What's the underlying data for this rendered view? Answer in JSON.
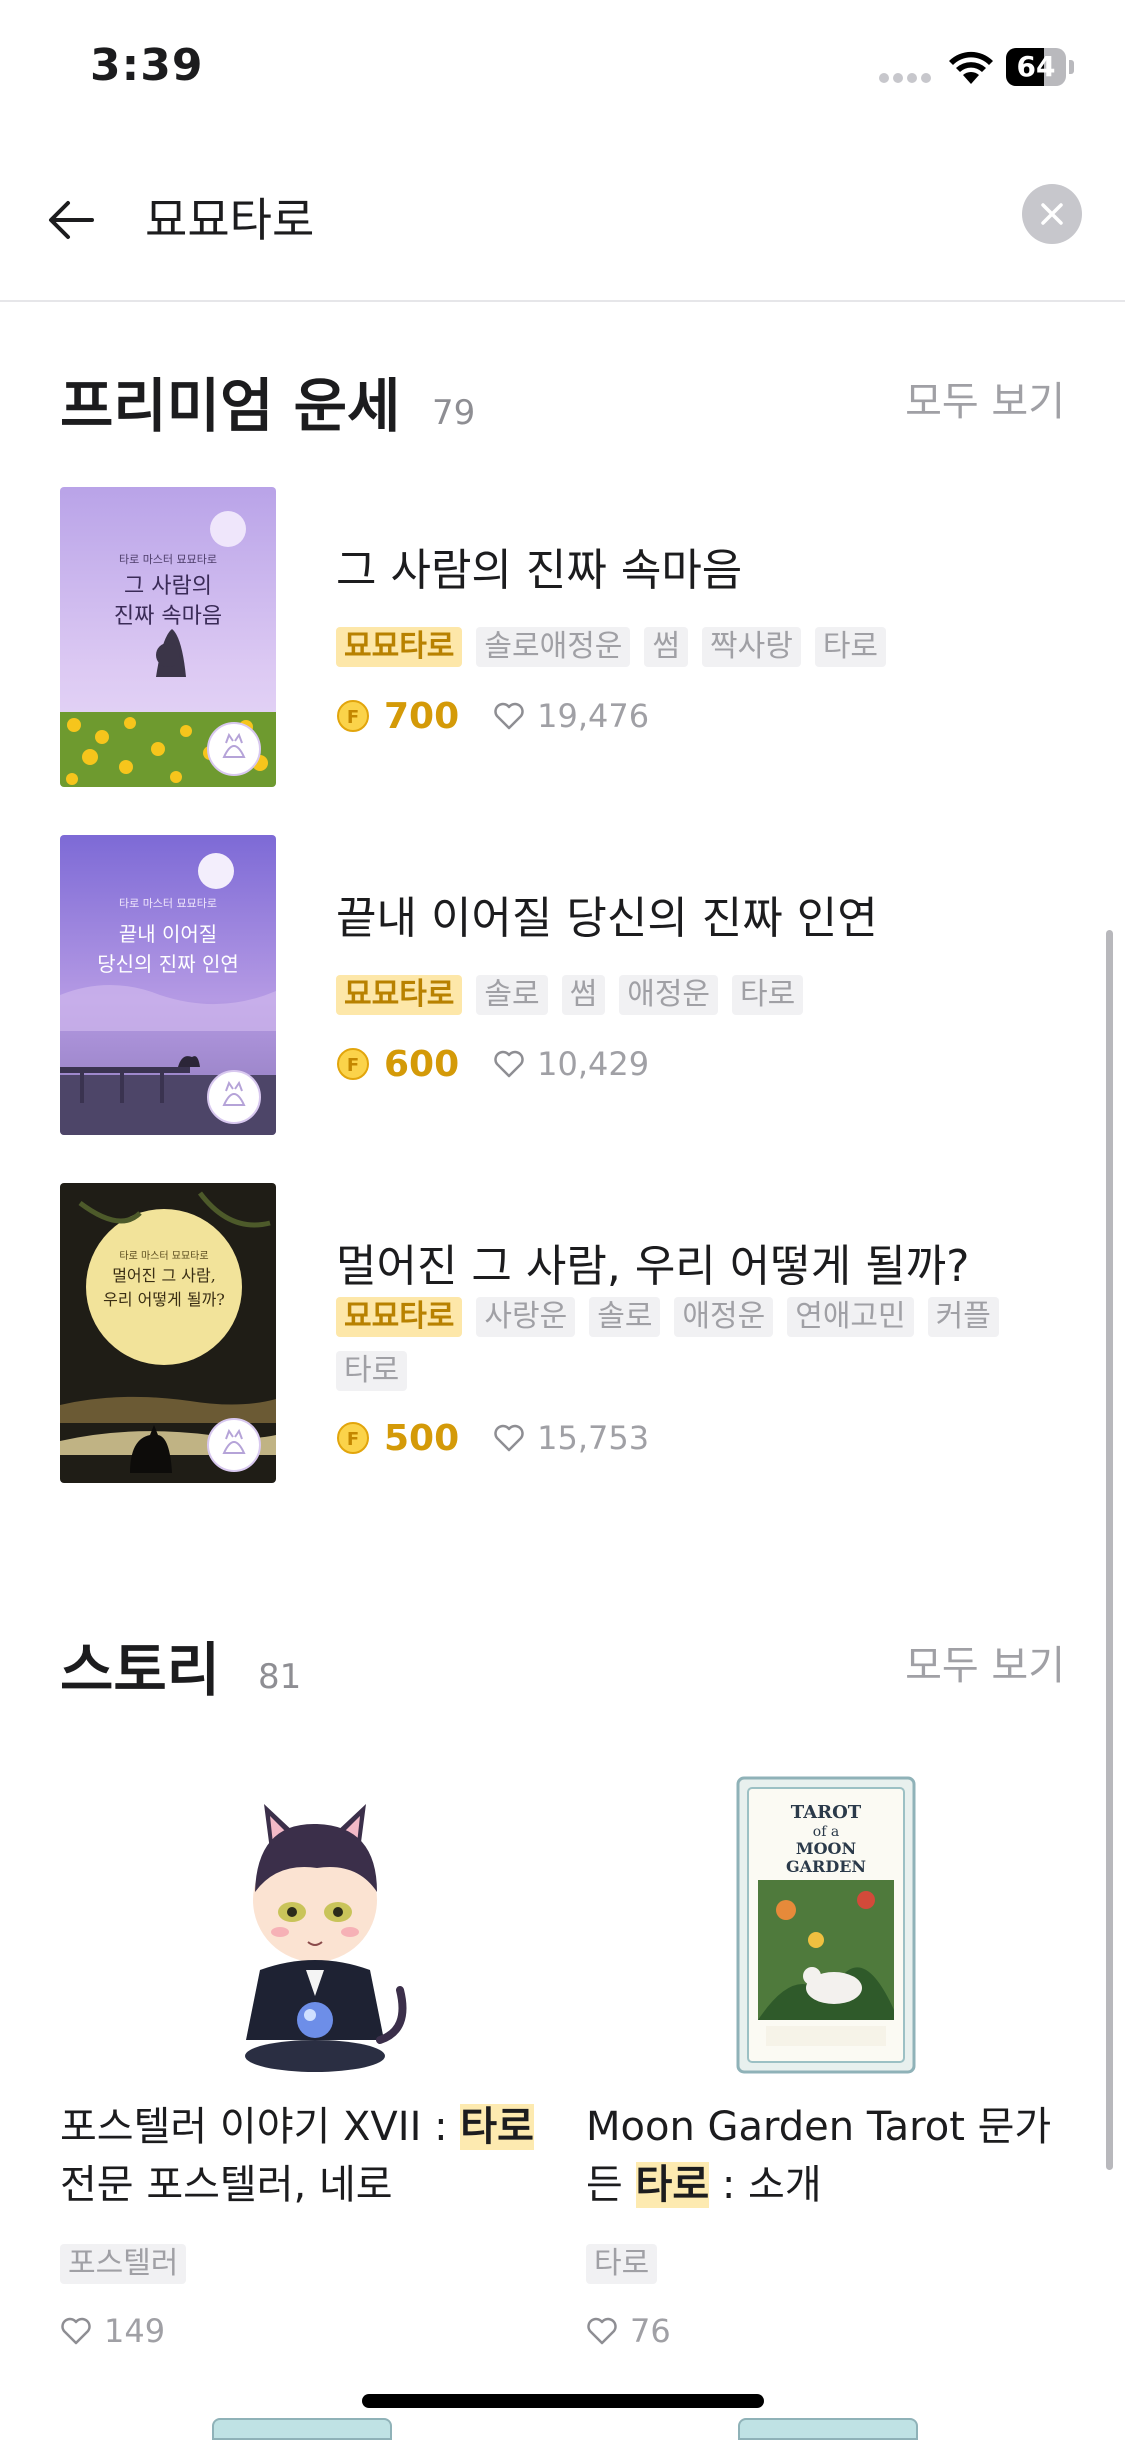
{
  "status_bar": {
    "time": "3:39",
    "battery": "64",
    "battery_level": 0.64
  },
  "search": {
    "query": "묘묘타로"
  },
  "premium": {
    "title": "프리미엄 운세",
    "count": "79",
    "see_all": "모두 보기",
    "items": [
      {
        "cover_top": "타로 마스터 묘묘타로",
        "cover_title_1": "그 사람의",
        "cover_title_2": "진짜 속마음",
        "title": "그 사람의 진짜 속마음",
        "brand": "묘묘타로",
        "tags": [
          "솔로애정운",
          "썸",
          "짝사랑",
          "타로"
        ],
        "price": "700",
        "likes": "19,476"
      },
      {
        "cover_top": "타로 마스터 묘묘타로",
        "cover_title_1": "끝내 이어질",
        "cover_title_2": "당신의 진짜 인연",
        "title": "끝내 이어질 당신의 진짜 인연",
        "brand": "묘묘타로",
        "tags": [
          "솔로",
          "썸",
          "애정운",
          "타로"
        ],
        "price": "600",
        "likes": "10,429"
      },
      {
        "cover_top": "타로 마스터 묘묘타로",
        "cover_title_1": "멀어진 그 사람,",
        "cover_title_2": "우리 어떻게 될까?",
        "title": "멀어진 그 사람, 우리 어떻게 될까?",
        "brand": "묘묘타로",
        "tags": [
          "사랑운",
          "솔로",
          "애정운",
          "연애고민",
          "커플",
          "타로"
        ],
        "price": "500",
        "likes": "15,753"
      }
    ]
  },
  "stories": {
    "title": "스토리",
    "count": "81",
    "see_all": "모두 보기",
    "items": [
      {
        "title_before": "포스텔러 이야기 XVII : ",
        "title_highlight": "타로",
        "title_after": " 전문 포스텔러, 네로",
        "tag": "포스텔러",
        "likes": "149"
      },
      {
        "title_before": "Moon Garden Tarot 문가든 ",
        "title_highlight": "타로",
        "title_after": " : 소개",
        "tag": "타로",
        "likes": "76",
        "card_title_1": "TAROT",
        "card_title_2": "of a",
        "card_title_3": "MOON",
        "card_title_4": "GARDEN"
      }
    ]
  }
}
